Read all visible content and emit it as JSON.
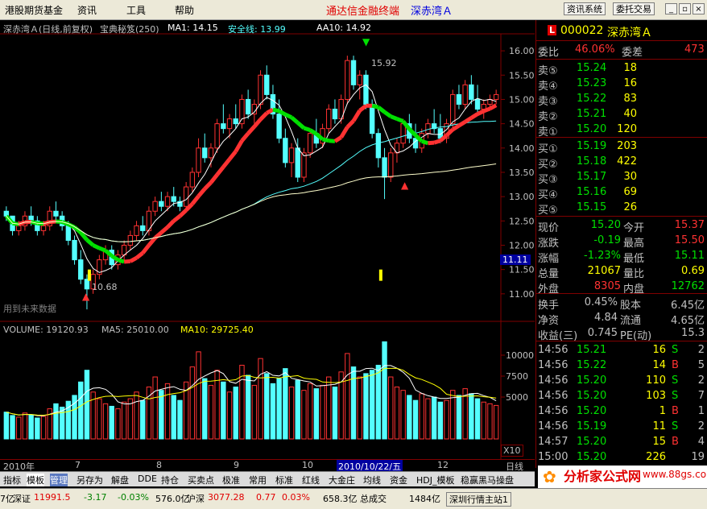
{
  "menu": {
    "items": [
      "港股期货基金",
      "资讯",
      "工具",
      "帮助"
    ],
    "app_title": "通达信金融终端",
    "stock_title": "深赤湾Ａ",
    "btn_news": "资讯系统",
    "btn_trade": "委托交易"
  },
  "chart_header": {
    "name": "深赤湾Ａ(日线,前复权)",
    "indicator": "宝典秘笈(250)",
    "ma1": "MA1: 14.15",
    "safe": "安全线: 13.99",
    "aa10": "AA10: 14.92",
    "watermark": "用到未来数据",
    "high_mark": "15.92",
    "low_mark": "10.68",
    "cursor_price": "11.11"
  },
  "volume_header": {
    "vol": "VOLUME: 19120.93",
    "ma5": "MA5: 25010.00",
    "ma10": "MA10: 29725.40",
    "x10": "X10"
  },
  "date_axis": {
    "labels": [
      "2010年",
      "7",
      "8",
      "9",
      "10",
      "2010/10/22/五",
      "12"
    ],
    "mode": "日线"
  },
  "chart_data": {
    "type": "candlestick",
    "price_axis": {
      "ticks": [
        11.0,
        11.5,
        12.0,
        12.5,
        13.0,
        13.5,
        14.0,
        14.5,
        15.0,
        15.5,
        16.0
      ],
      "range": [
        10.5,
        16.3
      ]
    },
    "volume_axis": {
      "ticks": [
        5000,
        7500,
        10000
      ],
      "range": [
        0,
        12500
      ]
    },
    "candles": [
      [
        12.7,
        12.8,
        12.5,
        12.6
      ],
      [
        12.6,
        12.6,
        12.2,
        12.3
      ],
      [
        12.3,
        12.5,
        12.2,
        12.4
      ],
      [
        12.4,
        12.7,
        12.3,
        12.6
      ],
      [
        12.6,
        12.8,
        12.4,
        12.5
      ],
      [
        12.5,
        12.6,
        12.2,
        12.3
      ],
      [
        12.3,
        12.5,
        12.2,
        12.4
      ],
      [
        12.4,
        12.8,
        12.3,
        12.7
      ],
      [
        12.7,
        12.9,
        12.5,
        12.6
      ],
      [
        12.6,
        12.7,
        12.3,
        12.4
      ],
      [
        12.4,
        12.5,
        12.0,
        12.1
      ],
      [
        12.1,
        12.2,
        11.6,
        11.7
      ],
      [
        11.7,
        11.9,
        11.2,
        11.3
      ],
      [
        11.3,
        11.4,
        10.68,
        11.1
      ],
      [
        11.1,
        11.5,
        11.0,
        11.4
      ],
      [
        11.4,
        11.8,
        11.3,
        11.7
      ],
      [
        11.7,
        12.0,
        11.6,
        11.9
      ],
      [
        11.9,
        12.0,
        11.5,
        11.6
      ],
      [
        11.6,
        11.9,
        11.5,
        11.8
      ],
      [
        11.8,
        12.1,
        11.7,
        12.0
      ],
      [
        12.0,
        12.3,
        11.9,
        12.2
      ],
      [
        12.2,
        12.5,
        12.1,
        12.4
      ],
      [
        12.4,
        12.6,
        12.2,
        12.3
      ],
      [
        12.3,
        12.8,
        12.2,
        12.7
      ],
      [
        12.7,
        13.0,
        12.6,
        12.9
      ],
      [
        12.9,
        13.1,
        12.7,
        12.8
      ],
      [
        12.8,
        13.1,
        12.7,
        13.0
      ],
      [
        13.0,
        13.2,
        12.8,
        12.9
      ],
      [
        12.9,
        13.0,
        12.7,
        12.8
      ],
      [
        12.8,
        13.3,
        12.7,
        13.2
      ],
      [
        13.2,
        13.6,
        13.1,
        13.5
      ],
      [
        13.5,
        14.2,
        13.4,
        14.0
      ],
      [
        14.0,
        14.3,
        13.7,
        13.8
      ],
      [
        13.8,
        14.1,
        13.6,
        14.0
      ],
      [
        14.0,
        14.6,
        13.9,
        14.5
      ],
      [
        14.5,
        14.9,
        14.3,
        14.4
      ],
      [
        14.4,
        14.7,
        14.2,
        14.6
      ],
      [
        14.6,
        14.9,
        14.4,
        14.5
      ],
      [
        14.5,
        15.1,
        14.4,
        15.0
      ],
      [
        15.0,
        15.2,
        14.6,
        14.7
      ],
      [
        14.7,
        15.0,
        14.5,
        14.9
      ],
      [
        14.9,
        15.6,
        14.8,
        15.5
      ],
      [
        15.5,
        15.7,
        15.0,
        15.1
      ],
      [
        15.1,
        15.3,
        14.6,
        14.7
      ],
      [
        14.7,
        15.0,
        14.1,
        14.2
      ],
      [
        14.2,
        14.4,
        13.6,
        13.7
      ],
      [
        13.7,
        14.1,
        13.4,
        14.0
      ],
      [
        14.0,
        14.2,
        13.3,
        13.4
      ],
      [
        13.4,
        14.0,
        13.3,
        13.9
      ],
      [
        13.9,
        14.4,
        13.8,
        14.3
      ],
      [
        14.3,
        14.6,
        14.0,
        14.1
      ],
      [
        14.1,
        14.5,
        14.0,
        14.4
      ],
      [
        14.4,
        14.9,
        14.3,
        14.8
      ],
      [
        14.8,
        15.0,
        14.5,
        14.6
      ],
      [
        14.6,
        15.1,
        14.5,
        15.0
      ],
      [
        15.0,
        15.9,
        14.9,
        15.8
      ],
      [
        15.8,
        15.9,
        15.2,
        15.3
      ],
      [
        15.3,
        15.6,
        15.0,
        15.5
      ],
      [
        15.5,
        15.6,
        14.8,
        14.9
      ],
      [
        14.9,
        15.0,
        14.2,
        14.3
      ],
      [
        14.3,
        14.4,
        13.6,
        13.8
      ],
      [
        13.8,
        14.0,
        12.95,
        13.4
      ],
      [
        13.4,
        14.0,
        13.3,
        13.9
      ],
      [
        13.9,
        14.2,
        13.7,
        14.1
      ],
      [
        14.1,
        14.6,
        14.0,
        14.5
      ],
      [
        14.5,
        14.7,
        14.1,
        14.2
      ],
      [
        14.2,
        14.5,
        13.9,
        14.0
      ],
      [
        14.0,
        14.4,
        13.9,
        14.3
      ],
      [
        14.3,
        14.6,
        14.2,
        14.5
      ],
      [
        14.5,
        14.8,
        14.3,
        14.4
      ],
      [
        14.4,
        14.7,
        14.1,
        14.2
      ],
      [
        14.2,
        14.6,
        14.1,
        14.5
      ],
      [
        14.5,
        15.2,
        14.4,
        15.1
      ],
      [
        15.1,
        15.3,
        14.8,
        14.9
      ],
      [
        14.9,
        15.4,
        14.8,
        15.3
      ],
      [
        15.3,
        15.5,
        14.9,
        15.0
      ],
      [
        15.0,
        15.3,
        14.7,
        14.8
      ],
      [
        14.8,
        15.0,
        14.6,
        14.9
      ],
      [
        14.9,
        15.1,
        14.8,
        15.0
      ],
      [
        15.0,
        15.2,
        14.9,
        15.1
      ]
    ],
    "volumes": [
      3200,
      2800,
      2600,
      3100,
      2900,
      2500,
      2700,
      3600,
      4200,
      3800,
      4500,
      5200,
      6800,
      8200,
      5600,
      4800,
      4200,
      3900,
      3600,
      4400,
      4800,
      5600,
      4600,
      6200,
      7400,
      5800,
      6600,
      5200,
      4600,
      6800,
      8600,
      10400,
      7200,
      6400,
      8200,
      6800,
      5600,
      6200,
      8800,
      7600,
      6400,
      9600,
      7800,
      6600,
      7200,
      8400,
      6200,
      7000,
      5800,
      6600,
      6000,
      6400,
      7400,
      6200,
      8000,
      10200,
      8600,
      7400,
      7800,
      8200,
      8800,
      11600,
      7400,
      6200,
      5800,
      5200,
      4600,
      5400,
      4800,
      5000,
      4400,
      4600,
      5800,
      5200,
      6000,
      5400,
      4800,
      4400,
      4200,
      4000
    ],
    "lines": [
      "MA1",
      "安全线",
      "AA10"
    ]
  },
  "quote": {
    "code": "000022",
    "name": "深赤湾Ａ",
    "l_badge": "L",
    "wb_label": "委比",
    "wb_value": "46.06%",
    "wc_label": "委差",
    "wc_value": "473",
    "sell": [
      {
        "label": "卖⑤",
        "price": "15.24",
        "vol": "18"
      },
      {
        "label": "卖④",
        "price": "15.23",
        "vol": "16"
      },
      {
        "label": "卖③",
        "price": "15.22",
        "vol": "83"
      },
      {
        "label": "卖②",
        "price": "15.21",
        "vol": "40"
      },
      {
        "label": "卖①",
        "price": "15.20",
        "vol": "120"
      }
    ],
    "buy": [
      {
        "label": "买①",
        "price": "15.19",
        "vol": "203"
      },
      {
        "label": "买②",
        "price": "15.18",
        "vol": "422"
      },
      {
        "label": "买③",
        "price": "15.17",
        "vol": "30"
      },
      {
        "label": "买④",
        "price": "15.16",
        "vol": "69"
      },
      {
        "label": "买⑤",
        "price": "15.15",
        "vol": "26"
      }
    ],
    "stats": [
      {
        "l1": "现价",
        "v1": "15.20",
        "l2": "今开",
        "v2": "15.37"
      },
      {
        "l1": "涨跌",
        "v1": "-0.19",
        "l2": "最高",
        "v2": "15.50"
      },
      {
        "l1": "涨幅",
        "v1": "-1.23%",
        "l2": "最低",
        "v2": "15.11"
      },
      {
        "l1": "总量",
        "v1": "21067",
        "l2": "量比",
        "v2": "0.69"
      },
      {
        "l1": "外盘",
        "v1": "8305",
        "l2": "内盘",
        "v2": "12762"
      }
    ],
    "stats2": [
      {
        "l1": "换手",
        "v1": "0.45%",
        "l2": "股本",
        "v2": "6.45亿"
      },
      {
        "l1": "净资",
        "v1": "4.84",
        "l2": "流通",
        "v2": "4.65亿"
      },
      {
        "l1": "收益(三)",
        "v1": "0.745",
        "l2": "PE(动)",
        "v2": "15.3"
      }
    ],
    "ticks": [
      {
        "t": "14:56",
        "p": "15.21",
        "v": "16",
        "s": "S"
      },
      {
        "t": "14:56",
        "p": "15.22",
        "v": "14",
        "s": "B"
      },
      {
        "t": "14:56",
        "p": "15.20",
        "v": "110",
        "s": "S"
      },
      {
        "t": "14:56",
        "p": "15.20",
        "v": "103",
        "s": "S"
      },
      {
        "t": "14:56",
        "p": "15.20",
        "v": "1",
        "s": "B"
      },
      {
        "t": "14:56",
        "p": "15.19",
        "v": "11",
        "s": "S"
      },
      {
        "t": "14:57",
        "p": "15.20",
        "v": "15",
        "s": "B"
      },
      {
        "t": "15:00",
        "p": "15.20",
        "v": "226",
        "s": ""
      }
    ],
    "tick_side_nums": [
      "2",
      "5",
      "2",
      "7",
      "1",
      "2",
      "4",
      "19"
    ]
  },
  "tabs": [
    "指标",
    "模板",
    "管理",
    "另存为",
    "解盘",
    "DDE",
    "持仓",
    "买卖点",
    "极准",
    "常用",
    "标准",
    "红线",
    "大金庄",
    "均线",
    "资金",
    "HDJ_模板",
    "稳赢黑马操盘"
  ],
  "status": {
    "a": "7亿",
    "sz_label": "深证",
    "sz_val": "11991.5",
    "sz_chg": "-3.17",
    "sz_pct": "-0.03%",
    "sz_amt": "576.0亿",
    "sh_label": "沪深",
    "sh_val": "3077.28",
    "sh_chg": "0.77",
    "sh_pct": "0.03%",
    "sh_amt": "658.3亿",
    "total_label": "总成交",
    "total_val": "1484亿",
    "server": "深圳行情主站1"
  },
  "logo": {
    "text": "分析家公式网",
    "url": "www.88gs.com"
  },
  "colors": {
    "up": "#ff3232",
    "down": "#54ffff",
    "red": "#ff3232",
    "green": "#00e000",
    "yellow": "#ffff00",
    "white": "#ffffff"
  }
}
